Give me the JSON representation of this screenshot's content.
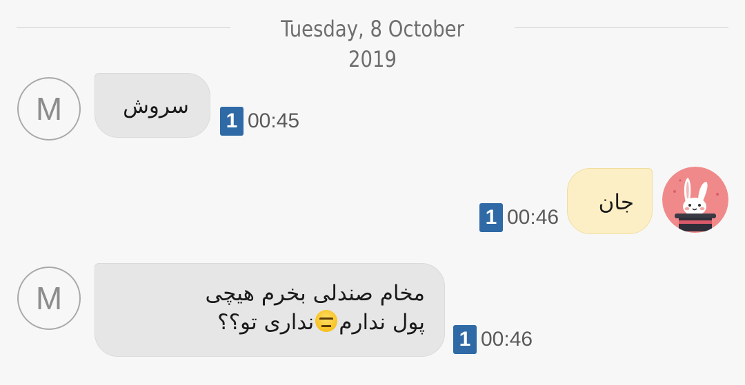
{
  "date_divider": "Tuesday, 8 October 2019",
  "colors": {
    "incoming_bubble": "#e6e6e6",
    "outgoing_bubble": "#fcefc6",
    "sim_badge": "#2f6aa6",
    "rabbit_avatar_bg": "#f08a8a"
  },
  "messages": [
    {
      "direction": "incoming",
      "avatar_letter": "M",
      "text": "سروش",
      "sim": "1",
      "time": "00:45"
    },
    {
      "direction": "outgoing",
      "avatar_icon": "rabbit-magic-hat-icon",
      "text": "جان",
      "sim": "1",
      "time": "00:46"
    },
    {
      "direction": "incoming",
      "avatar_letter": "M",
      "text_line1": "مخام صندلی بخرم هیچی",
      "text_line2_before_emoji": "پول ندارم",
      "emoji": "expressionless-face-emoji",
      "text_line2_after_emoji": "نداری تو؟؟",
      "sim": "1",
      "time": "00:46"
    }
  ]
}
